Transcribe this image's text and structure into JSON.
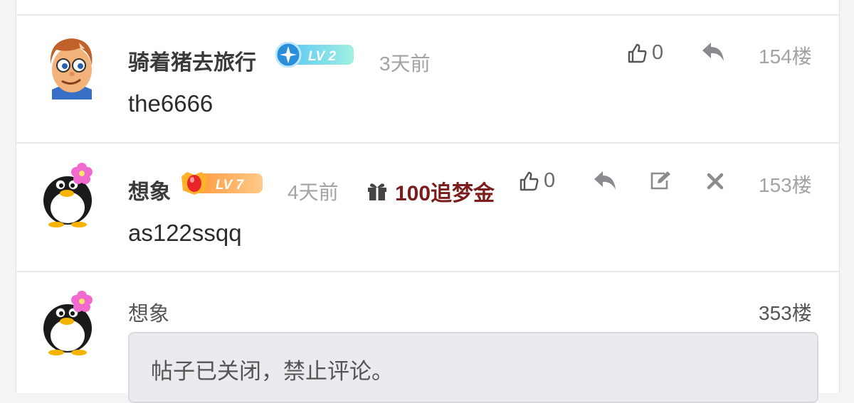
{
  "colors": {
    "reward_text": "#7a1d1d",
    "meta_gray": "#a3a3a6",
    "accent_lv2": "#39b8e6",
    "accent_lv7": "#ff7a3d"
  },
  "comments": [
    {
      "username": "骑着猪去旅行",
      "level": "LV 2",
      "time": "3天前",
      "likes": "0",
      "floor": "154楼",
      "content": "the6666",
      "icons": [
        "thumbs-up-icon",
        "reply-icon"
      ]
    },
    {
      "username": "想象",
      "level": "LV 7",
      "time": "4天前",
      "reward": "100追梦金",
      "likes": "0",
      "floor": "153楼",
      "content": "as122ssqq",
      "icons": [
        "gift-icon",
        "thumbs-up-icon",
        "reply-icon",
        "edit-icon",
        "close-icon"
      ]
    }
  ],
  "composer": {
    "username": "想象",
    "floor": "353楼",
    "notice": "帖子已关闭，禁止评论。"
  }
}
